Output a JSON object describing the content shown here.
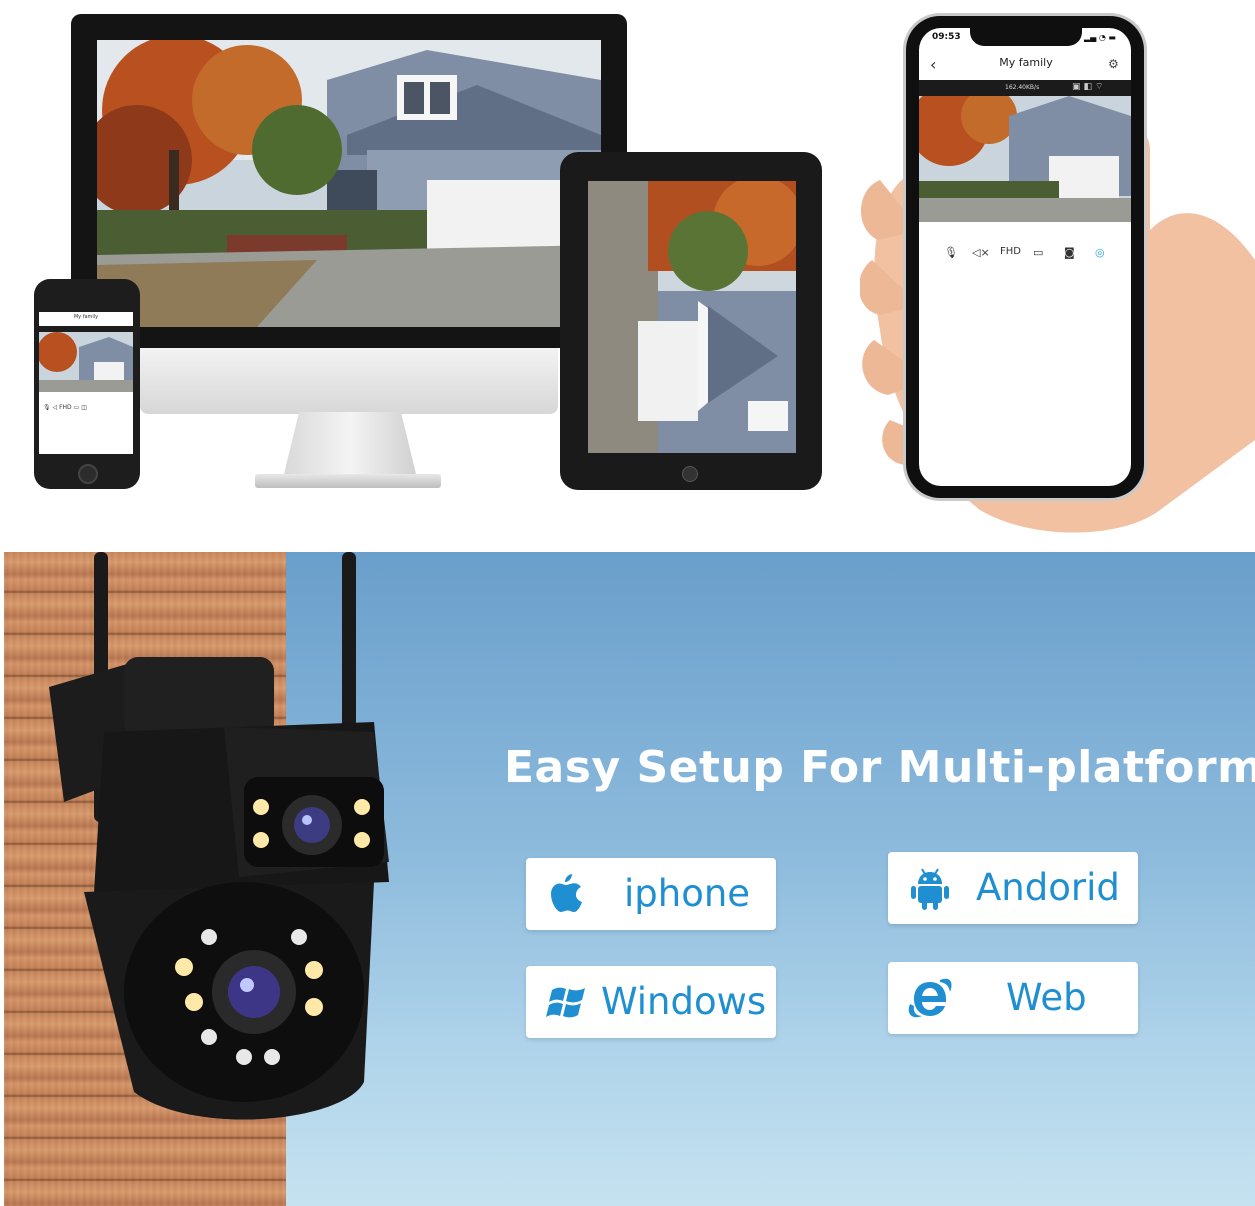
{
  "headline": "Easy Setup For Multi-platform",
  "platforms": [
    {
      "label": "iphone",
      "icon": "apple-icon"
    },
    {
      "label": "Andorid",
      "icon": "android-icon"
    },
    {
      "label": "Windows",
      "icon": "windows-icon"
    },
    {
      "label": "Web",
      "icon": "internet-explorer-icon"
    }
  ],
  "phone_app": {
    "time": "09:53",
    "title": "My family",
    "rate": "162.40KB/s",
    "quality": "FHD"
  },
  "small_phone_app": {
    "title": "My family",
    "quality": "FHD"
  },
  "colors": {
    "accent_blue": "#1f8fd1",
    "sky_top": "#6a9fcb",
    "sky_bottom": "#c6e2f0"
  }
}
